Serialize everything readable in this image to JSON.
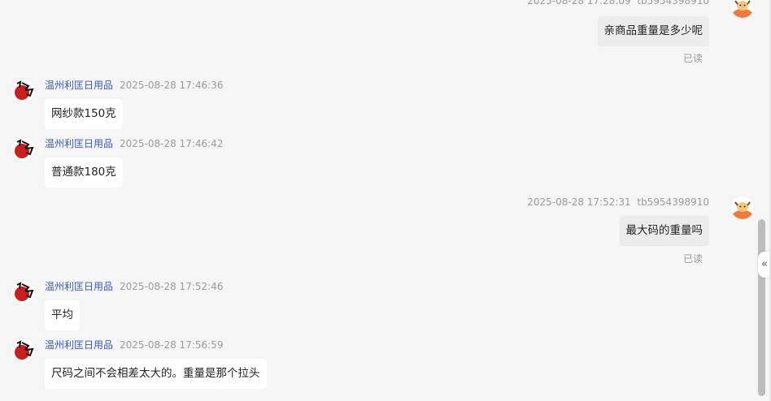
{
  "messages": [
    {
      "side": "right",
      "time": "2025-08-28 17:28:09",
      "sender": "tb5954398910",
      "text": "亲商品重量是多少呢",
      "status": "已读"
    },
    {
      "side": "left",
      "sender": "温州利匡日用品",
      "time": "2025-08-28 17:46:36",
      "text": "网纱款150克"
    },
    {
      "side": "left",
      "sender": "温州利匡日用品",
      "time": "2025-08-28 17:46:42",
      "text": "普通款180克"
    },
    {
      "side": "right",
      "time": "2025-08-28 17:52:31",
      "sender": "tb5954398910",
      "text": "最大码的重量吗",
      "status": "已读"
    },
    {
      "side": "left",
      "sender": "温州利匡日用品",
      "time": "2025-08-28 17:52:46",
      "text": "平均"
    },
    {
      "side": "left",
      "sender": "温州利匡日用品",
      "time": "2025-08-28 17:56:59",
      "text": "尺码之间不会相差太大的。重量是那个拉头"
    }
  ],
  "collapse_glyph": "«",
  "colors": {
    "sender_name": "#3a59b7",
    "meta_text": "#9a9a9a",
    "background": "#f5f5f5"
  },
  "icons": {
    "shop_avatar": "shop-logo-avatar-icon",
    "buyer_avatar": "ox-avatar-icon"
  }
}
